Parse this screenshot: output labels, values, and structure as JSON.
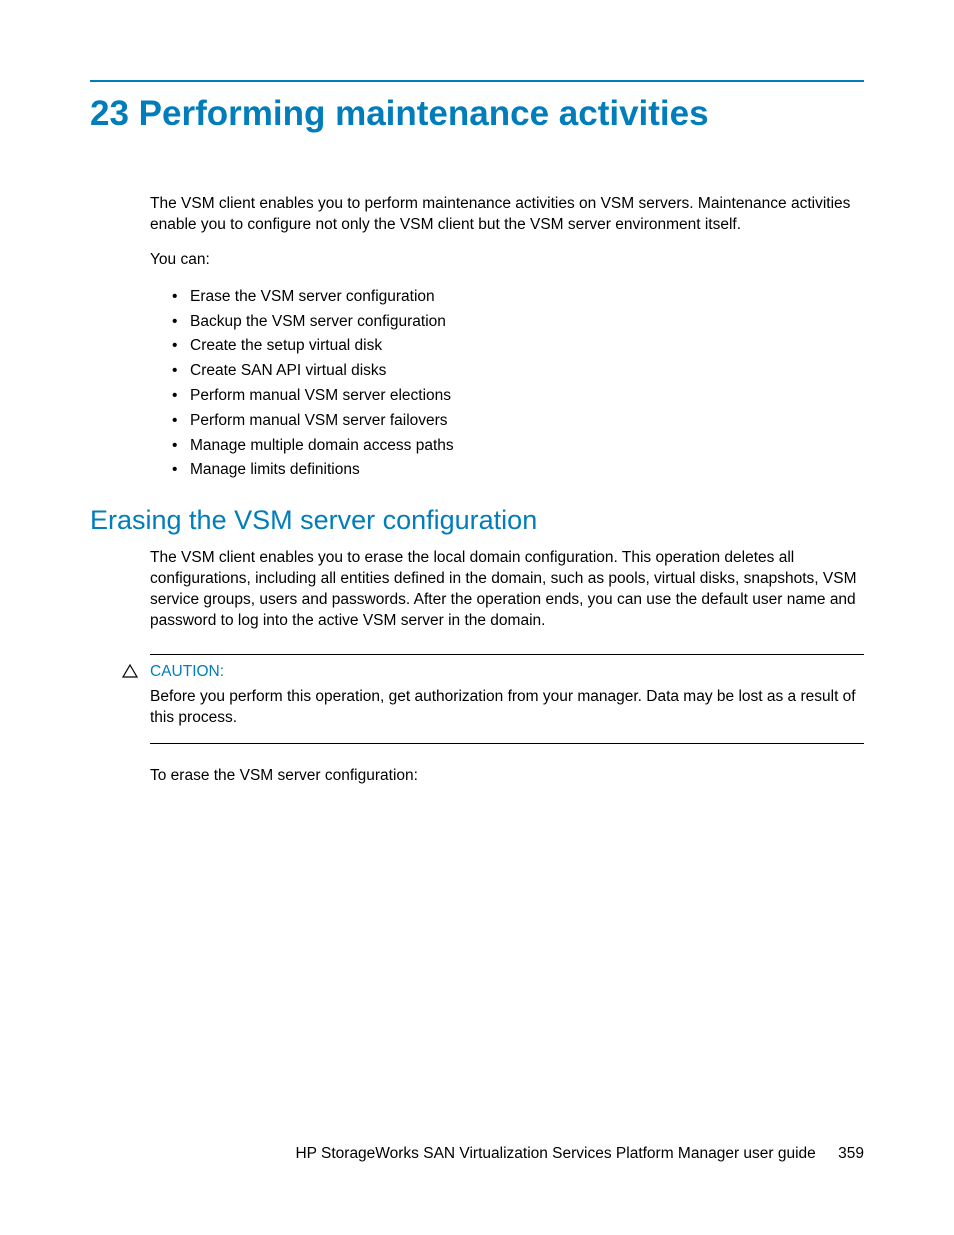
{
  "chapter": {
    "number": "23",
    "title": "Performing maintenance activities"
  },
  "intro": {
    "p1": "The VSM client enables you to perform maintenance activities on VSM servers. Maintenance activities enable you to configure not only the VSM client but the VSM server environment itself.",
    "p2": "You can:"
  },
  "bullets": [
    "Erase the VSM server configuration",
    "Backup the VSM server configuration",
    "Create the setup virtual disk",
    "Create SAN API virtual disks",
    "Perform manual VSM server elections",
    "Perform manual VSM server failovers",
    "Manage multiple domain access paths",
    "Manage limits definitions"
  ],
  "section": {
    "title": "Erasing the VSM server configuration",
    "p1": "The VSM client enables you to erase the local domain configuration. This operation deletes all configurations, including all entities defined in the domain, such as pools, virtual disks, snapshots, VSM service groups, users and passwords. After the operation ends, you can use the default user name and password to log into the active VSM server in the domain."
  },
  "caution": {
    "label": "CAUTION:",
    "text": "Before you perform this operation, get authorization from your manager. Data may be lost as a result of this process."
  },
  "after_caution": "To erase the VSM server configuration:",
  "footer": {
    "doc_title": "HP StorageWorks SAN Virtualization Services Platform Manager user guide",
    "page_number": "359"
  }
}
